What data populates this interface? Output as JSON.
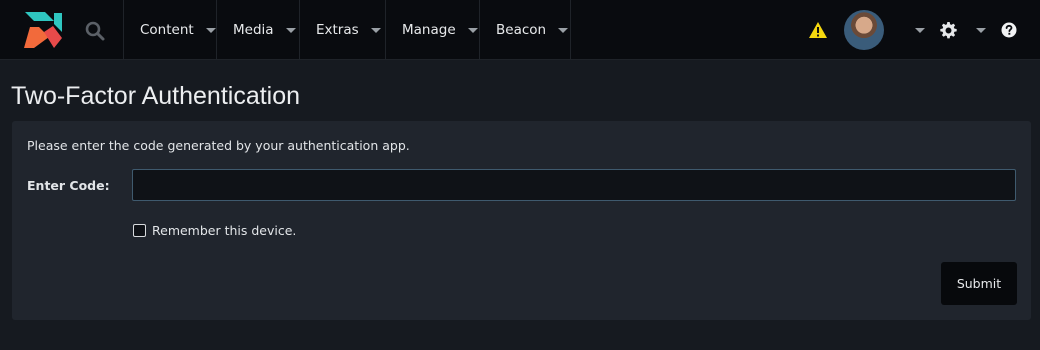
{
  "header": {
    "nav": [
      {
        "label": "Content"
      },
      {
        "label": "Media"
      },
      {
        "label": "Extras"
      },
      {
        "label": "Manage"
      },
      {
        "label": "Beacon"
      }
    ],
    "icons": {
      "logo": "modx-logo-icon",
      "search": "search-icon",
      "alert": "warning-icon",
      "settings": "gear-icon",
      "help": "help-icon"
    },
    "colors": {
      "warning": "#f5d80f",
      "logo_teal": "#2fc6c0",
      "logo_orange": "#f26a3b",
      "logo_red": "#e84a4a"
    }
  },
  "page": {
    "title": "Two-Factor Authentication"
  },
  "form": {
    "instructions": "Please enter the code generated by your authentication app.",
    "code_label": "Enter Code:",
    "code_value": "",
    "code_placeholder": "",
    "remember_label": "Remember this device.",
    "remember_checked": false,
    "submit_label": "Submit"
  }
}
